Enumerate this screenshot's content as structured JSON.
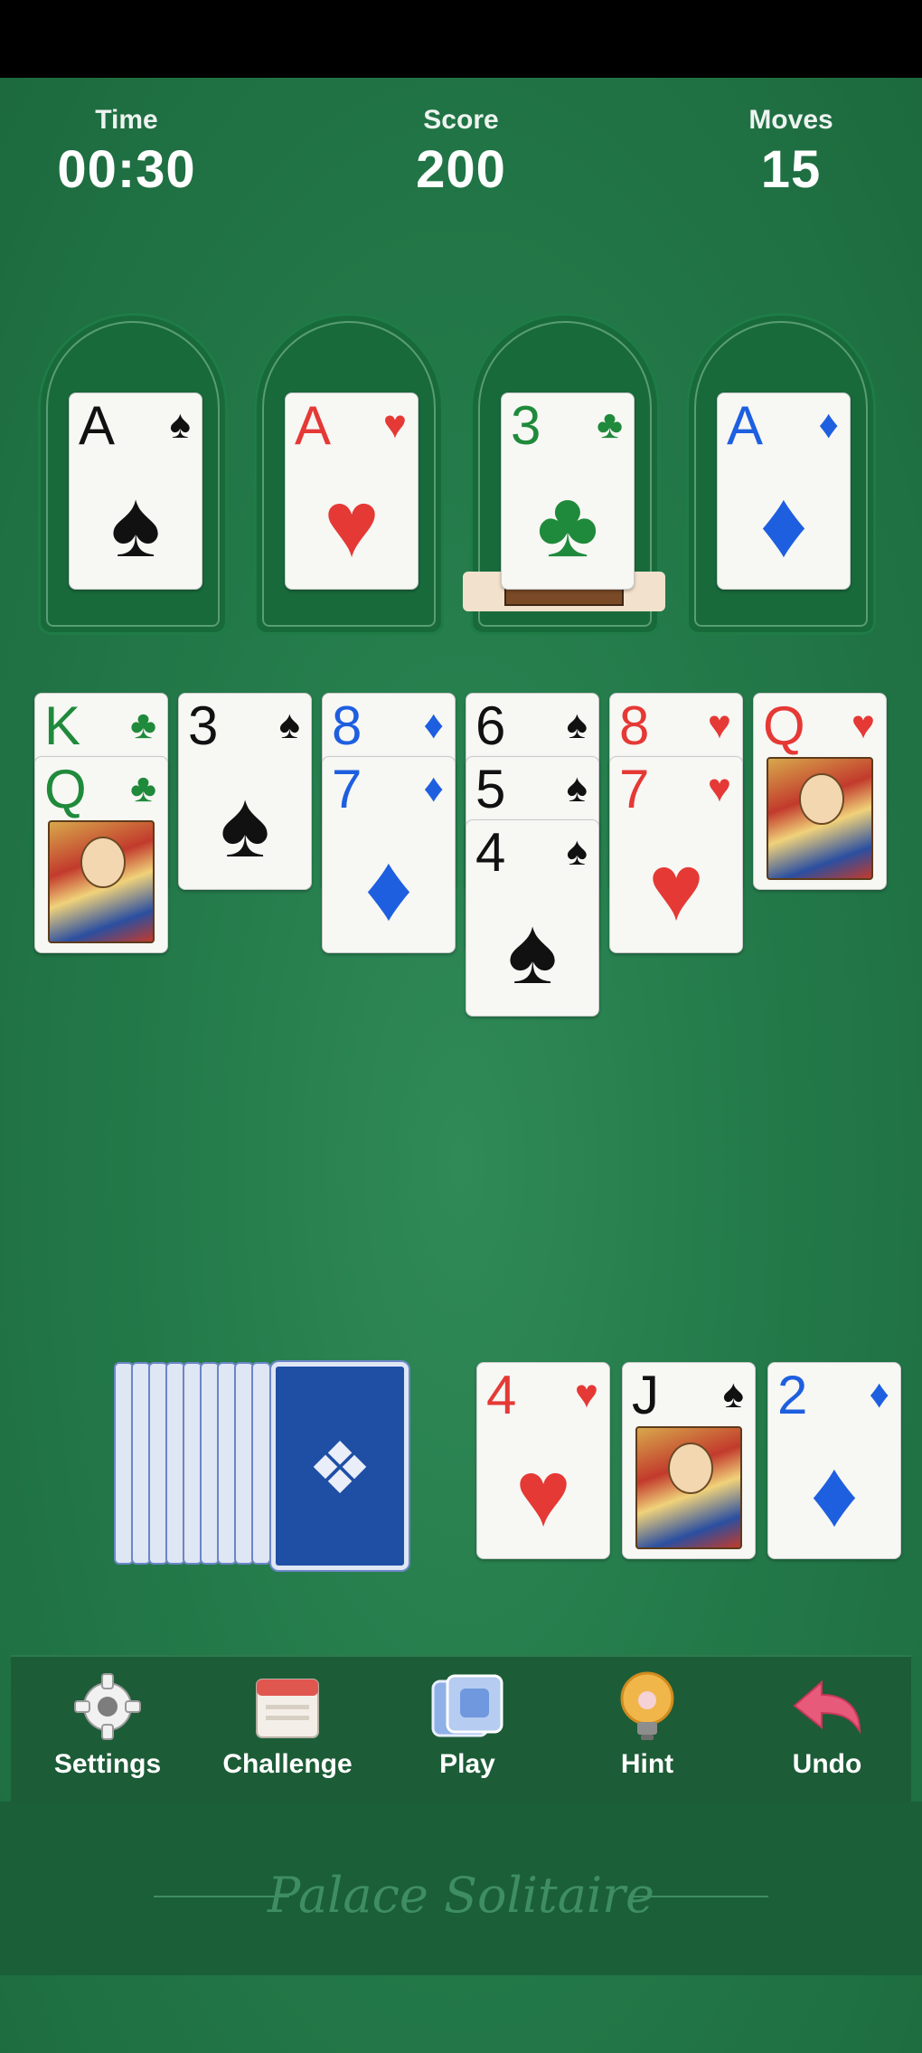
{
  "stats": {
    "time_label": "Time",
    "time_value": "00:30",
    "score_label": "Score",
    "score_value": "200",
    "moves_label": "Moves",
    "moves_value": "15"
  },
  "foundations": [
    {
      "rank": "A",
      "suit": "♠",
      "color": "blk"
    },
    {
      "rank": "A",
      "suit": "♥",
      "color": "red"
    },
    {
      "rank": "3",
      "suit": "♣",
      "color": "grn"
    },
    {
      "rank": "A",
      "suit": "♦",
      "color": "blu"
    }
  ],
  "tableau": [
    [
      {
        "rank": "K",
        "suit": "♣",
        "color": "grn"
      },
      {
        "rank": "Q",
        "suit": "♣",
        "color": "grn",
        "face": true
      }
    ],
    [
      {
        "rank": "3",
        "suit": "♠",
        "color": "blk"
      }
    ],
    [
      {
        "rank": "8",
        "suit": "♦",
        "color": "blu"
      },
      {
        "rank": "7",
        "suit": "♦",
        "color": "blu"
      }
    ],
    [
      {
        "rank": "6",
        "suit": "♠",
        "color": "blk"
      },
      {
        "rank": "5",
        "suit": "♠",
        "color": "blk"
      },
      {
        "rank": "4",
        "suit": "♠",
        "color": "blk"
      }
    ],
    [
      {
        "rank": "8",
        "suit": "♥",
        "color": "red"
      },
      {
        "rank": "7",
        "suit": "♥",
        "color": "red"
      }
    ],
    [
      {
        "rank": "Q",
        "suit": "♥",
        "color": "red",
        "face": true
      }
    ]
  ],
  "waste": [
    {
      "rank": "4",
      "suit": "♥",
      "color": "red"
    },
    {
      "rank": "J",
      "suit": "♠",
      "color": "blk",
      "face": true
    },
    {
      "rank": "2",
      "suit": "♦",
      "color": "blu"
    }
  ],
  "stock_count": 9,
  "toolbar": {
    "settings": "Settings",
    "challenge": "Challenge",
    "play": "Play",
    "hint": "Hint",
    "undo": "Undo"
  },
  "brand": "Palace Solitaire"
}
